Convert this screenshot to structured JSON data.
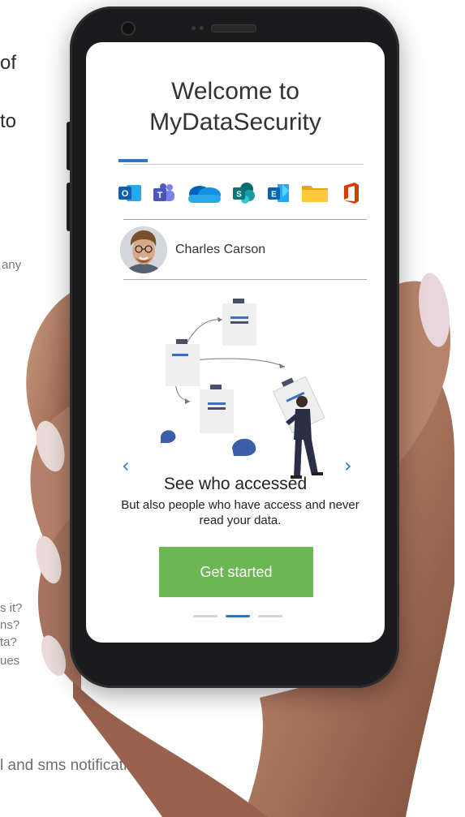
{
  "background_text": {
    "line1": "of",
    "line2": "to",
    "line3": "any",
    "q1": "s it?",
    "q2": "ns?",
    "q3": "ta?",
    "q4": "ues",
    "bottom": "l and sms notifications."
  },
  "screen": {
    "title_line1": "Welcome to",
    "title_line2": "MyDataSecurity",
    "apps": [
      {
        "name": "outlook-icon",
        "color": "#1565c0",
        "letter": "O"
      },
      {
        "name": "teams-icon",
        "color": "#5059c9",
        "letter": "T"
      },
      {
        "name": "onedrive-icon",
        "color": "#0f6cbd"
      },
      {
        "name": "sharepoint-icon",
        "color": "#038387",
        "letter": "S"
      },
      {
        "name": "exchange-icon",
        "color": "#0a64ad",
        "letter": "E"
      },
      {
        "name": "folder-icon",
        "color": "#f5c518"
      },
      {
        "name": "office-icon",
        "color": "#d83b01"
      }
    ],
    "user_name": "Charles Carson",
    "slide_title": "See who accessed",
    "slide_desc": "But also people who have access and never read your data.",
    "cta_label": "Get started",
    "prev_arrow": "‹",
    "next_arrow": "›",
    "dots": [
      false,
      true,
      false
    ]
  },
  "colors": {
    "accent": "#2e78c2",
    "cta": "#6cb653"
  }
}
